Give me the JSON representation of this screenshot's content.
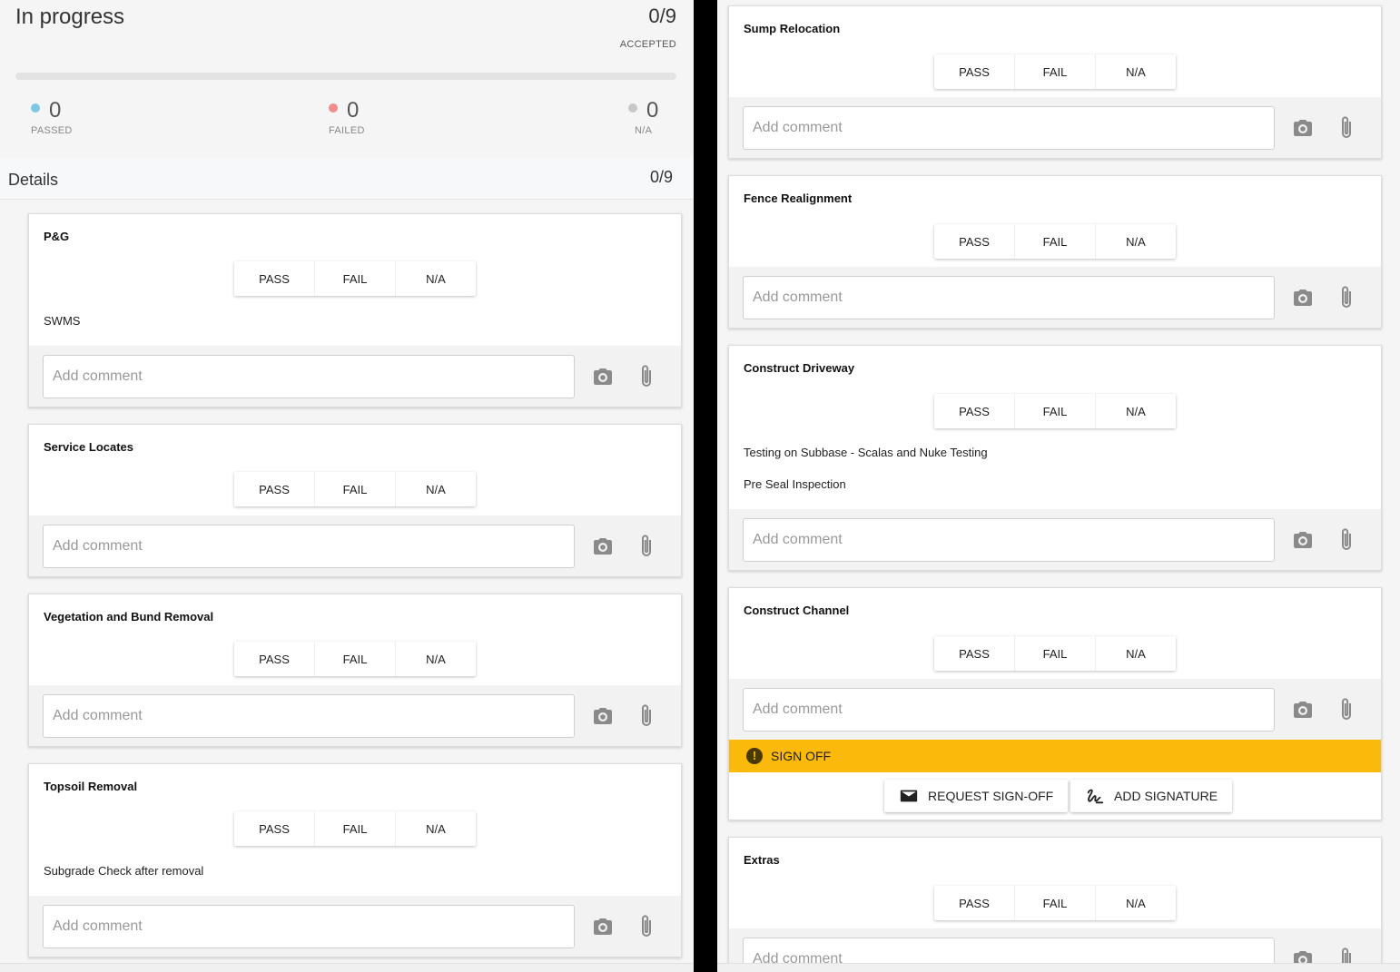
{
  "summary": {
    "title": "In progress",
    "count": "0/9",
    "accepted_label": "ACCEPTED",
    "passed": {
      "value": "0",
      "label": "PASSED",
      "color": "#7ec8e3"
    },
    "failed": {
      "value": "0",
      "label": "FAILED",
      "color": "#f08c8c"
    },
    "na": {
      "value": "0",
      "label": "N/A",
      "color": "#c8c8c8"
    }
  },
  "details": {
    "label": "Details",
    "count": "0/9"
  },
  "buttons": {
    "pass": "PASS",
    "fail": "FAIL",
    "na": "N/A"
  },
  "comment_placeholder": "Add comment",
  "left_cards": [
    {
      "title": "P&G",
      "notes": [
        "SWMS"
      ]
    },
    {
      "title": "Service Locates",
      "notes": []
    },
    {
      "title": "Vegetation and Bund Removal",
      "notes": []
    },
    {
      "title": "Topsoil Removal",
      "notes": [
        "Subgrade Check after removal"
      ]
    }
  ],
  "right_cards": [
    {
      "title": "Sump Relocation",
      "notes": []
    },
    {
      "title": "Fence Realignment",
      "notes": []
    },
    {
      "title": "Construct Driveway",
      "notes": [
        "Testing on Subbase - Scalas and Nuke Testing",
        "Pre Seal Inspection"
      ]
    },
    {
      "title": "Construct Channel",
      "notes": []
    },
    {
      "title": "Extras",
      "notes": []
    }
  ],
  "signoff": {
    "label": "SIGN OFF",
    "color": "#fbb90c",
    "request_label": "REQUEST SIGN-OFF",
    "signature_label": "ADD SIGNATURE"
  }
}
